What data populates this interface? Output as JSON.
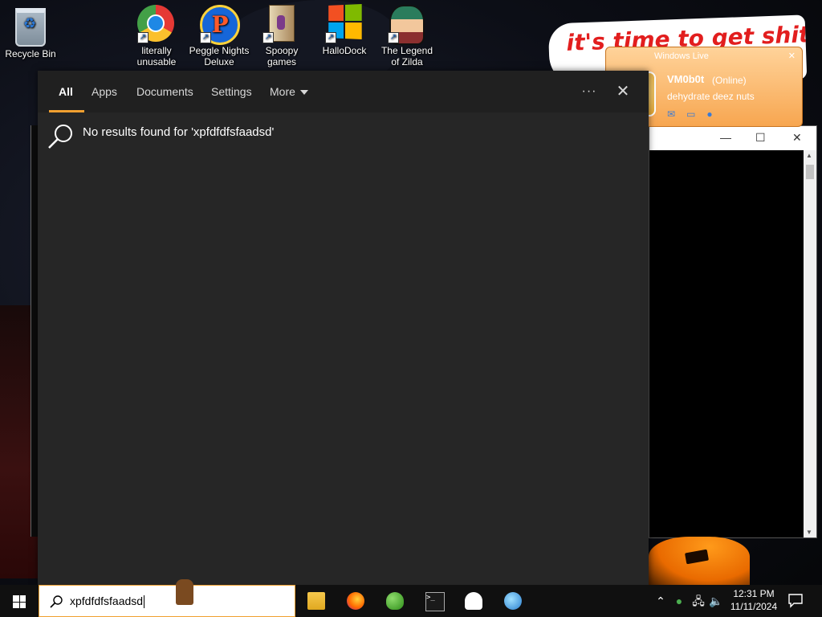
{
  "desktop": {
    "icons": [
      {
        "label": "Recycle Bin",
        "icon": "recycle-bin-icon"
      },
      {
        "label": "literally unusable",
        "icon": "chrome-icon"
      },
      {
        "label": "Peggle Nights Deluxe",
        "icon": "peggle-icon"
      },
      {
        "label": "Spoopy games",
        "icon": "spoopy-games-icon"
      },
      {
        "label": "HalloDock",
        "icon": "windows-flag-icon"
      },
      {
        "label": "The Legend of Zilda",
        "icon": "zilda-icon"
      }
    ],
    "banner_text": "it's time to get shit",
    "wlive": {
      "title": "Windows Live",
      "nickname": "VM0b0t",
      "status": "(Online)",
      "message": "dehydrate deez nuts"
    }
  },
  "search": {
    "tabs": [
      "All",
      "Apps",
      "Documents",
      "Settings",
      "More"
    ],
    "active_tab": "All",
    "no_results_text": "No results found for 'xpfdfdfsfaadsd'",
    "query": "xpfdfdfsfaadsd"
  },
  "taskbar": {
    "apps": [
      "file-explorer-icon",
      "firefox-icon",
      "messenger-icon",
      "command-prompt-icon",
      "people-icon",
      "network-globe-icon"
    ],
    "time": "12:31 PM",
    "date": "11/11/2024"
  },
  "colors": {
    "accent": "#f0a030",
    "panel_bg": "#262626",
    "tabbar_bg": "#202020",
    "taskbar_bg": "#101010",
    "banner_text": "#e21e1e"
  }
}
